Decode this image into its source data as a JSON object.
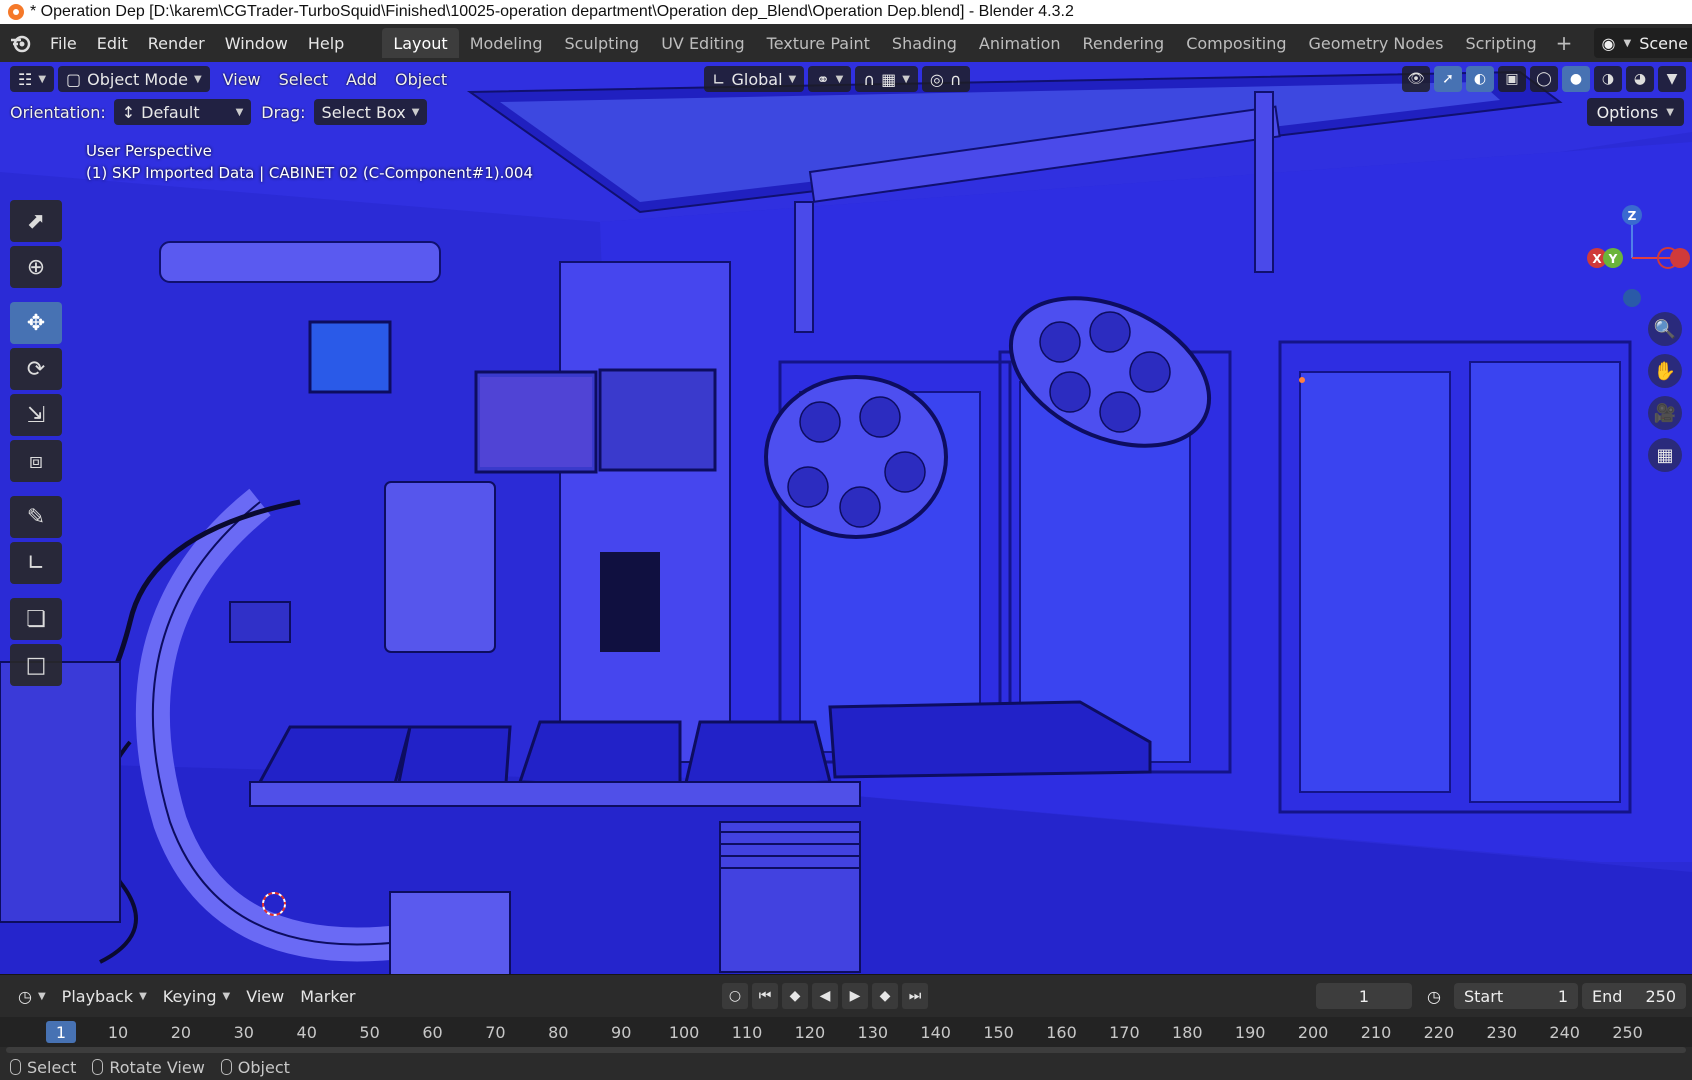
{
  "window": {
    "title": "* Operation Dep [D:\\karem\\CGTrader-TurboSquid\\Finished\\10025-operation department\\Operation dep_Blend\\Operation Dep.blend] - Blender 4.3.2"
  },
  "menubar": {
    "items": [
      "File",
      "Edit",
      "Render",
      "Window",
      "Help"
    ],
    "workspaces": [
      "Layout",
      "Modeling",
      "Sculpting",
      "UV Editing",
      "Texture Paint",
      "Shading",
      "Animation",
      "Rendering",
      "Compositing",
      "Geometry Nodes",
      "Scripting"
    ],
    "active_workspace": "Layout",
    "scene_label": "Scene"
  },
  "viewport_header": {
    "mode": "Object Mode",
    "menus": [
      "View",
      "Select",
      "Add",
      "Object"
    ],
    "transform_orientation": "Global"
  },
  "tool_settings": {
    "orientation_label": "Orientation:",
    "orientation_value": "Default",
    "drag_label": "Drag:",
    "drag_value": "Select Box",
    "options_label": "Options"
  },
  "viewport_info": {
    "perspective": "User Perspective",
    "active_object": "(1) SKP Imported Data | CABINET 02 (C-Component#1).004"
  },
  "gizmo": {
    "z": "Z",
    "y": "Y",
    "x": "X"
  },
  "timeline": {
    "menus": [
      "Playback",
      "Keying",
      "View",
      "Marker"
    ],
    "current_frame": "1",
    "start_label": "Start",
    "start_value": "1",
    "end_label": "End",
    "end_value": "250",
    "ruler_labels": [
      "1",
      "10",
      "20",
      "30",
      "40",
      "50",
      "60",
      "70",
      "80",
      "90",
      "100",
      "110",
      "120",
      "130",
      "140",
      "150",
      "160",
      "170",
      "180",
      "190",
      "200",
      "210",
      "220",
      "230",
      "240",
      "250"
    ]
  },
  "statusbar": {
    "items": [
      "Select",
      "Rotate View",
      "Object"
    ]
  },
  "colors": {
    "viewport_bg": "#2a2ad8",
    "accent": "#4772b3"
  }
}
